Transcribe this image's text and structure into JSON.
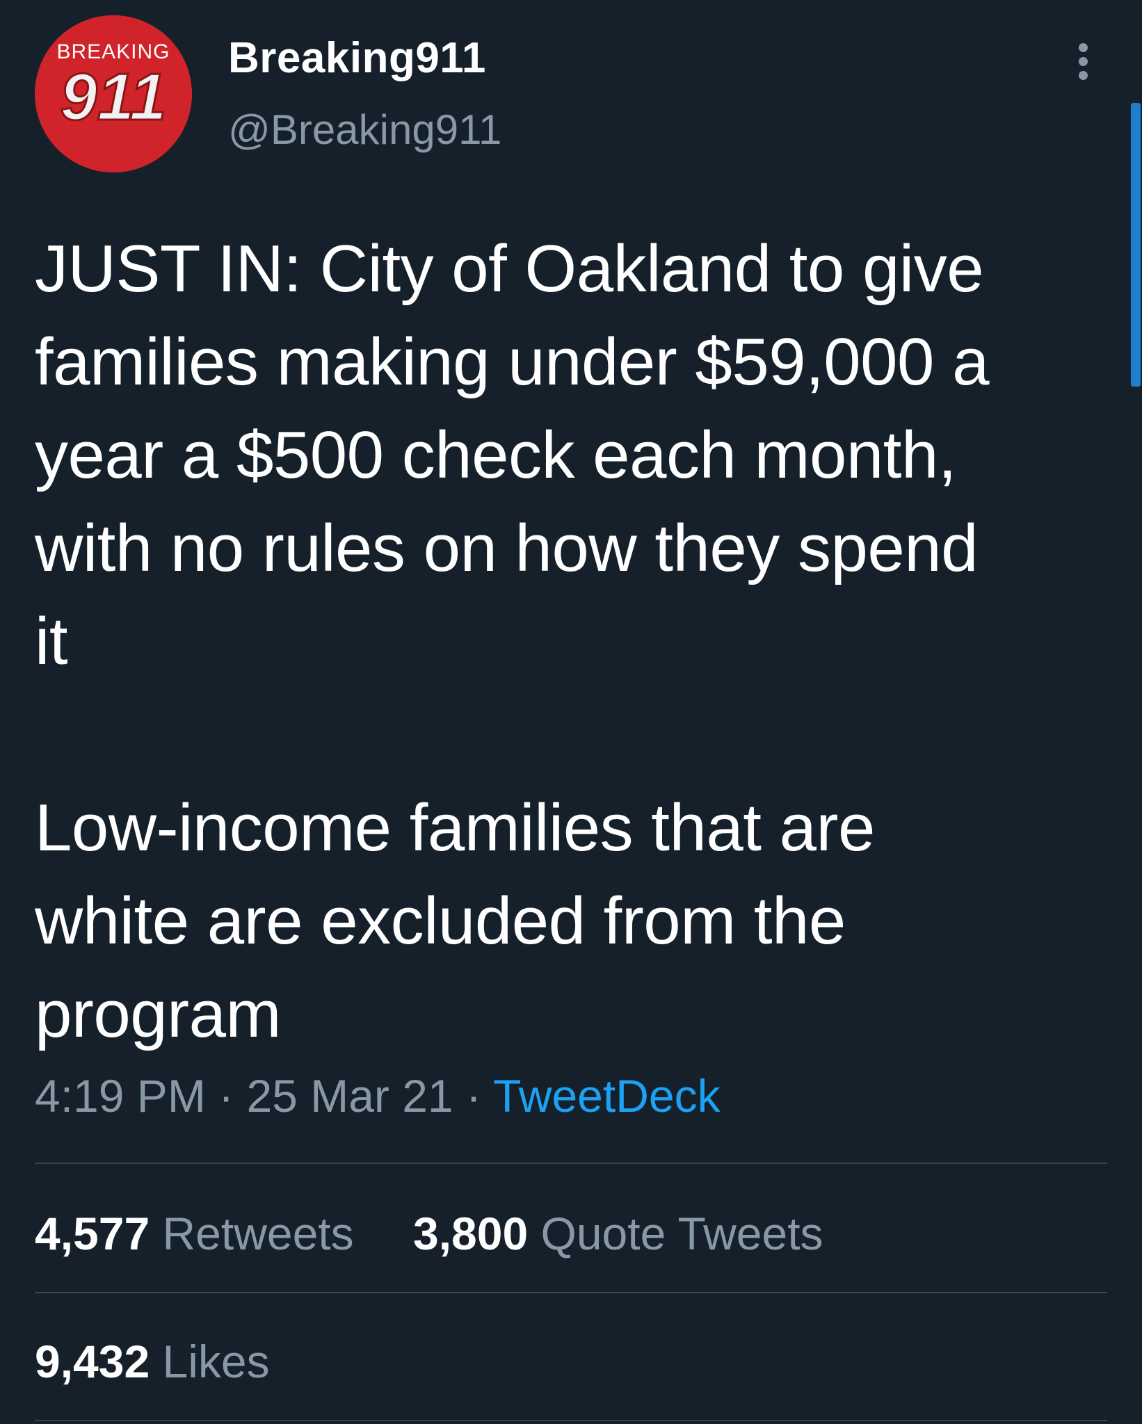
{
  "user": {
    "display_name": "Breaking911",
    "handle": "@Breaking911",
    "avatar_icon": "breaking911-logo",
    "avatar_color": "#d1232a"
  },
  "header": {
    "more_icon": "more-vertical-icon"
  },
  "tweet": {
    "text": "JUST IN: City of Oakland to give\nfamilies making under $59,000 a\nyear a $500 check each month,\nwith no rules on how they spend\nit\n\nLow-income families that are\nwhite are excluded from the\nprogram",
    "time": "4:19 PM",
    "separator": "·",
    "date": "25 Mar 21",
    "source": "TweetDeck"
  },
  "stats": {
    "retweets_count": "4,577",
    "retweets_label": "Retweets",
    "quotes_count": "3,800",
    "quotes_label": "Quote Tweets",
    "likes_count": "9,432",
    "likes_label": "Likes"
  },
  "colors": {
    "background": "#15202b",
    "text": "#ffffff",
    "secondary": "#8899a6",
    "accent": "#1da1f2",
    "divider": "#38444d"
  }
}
